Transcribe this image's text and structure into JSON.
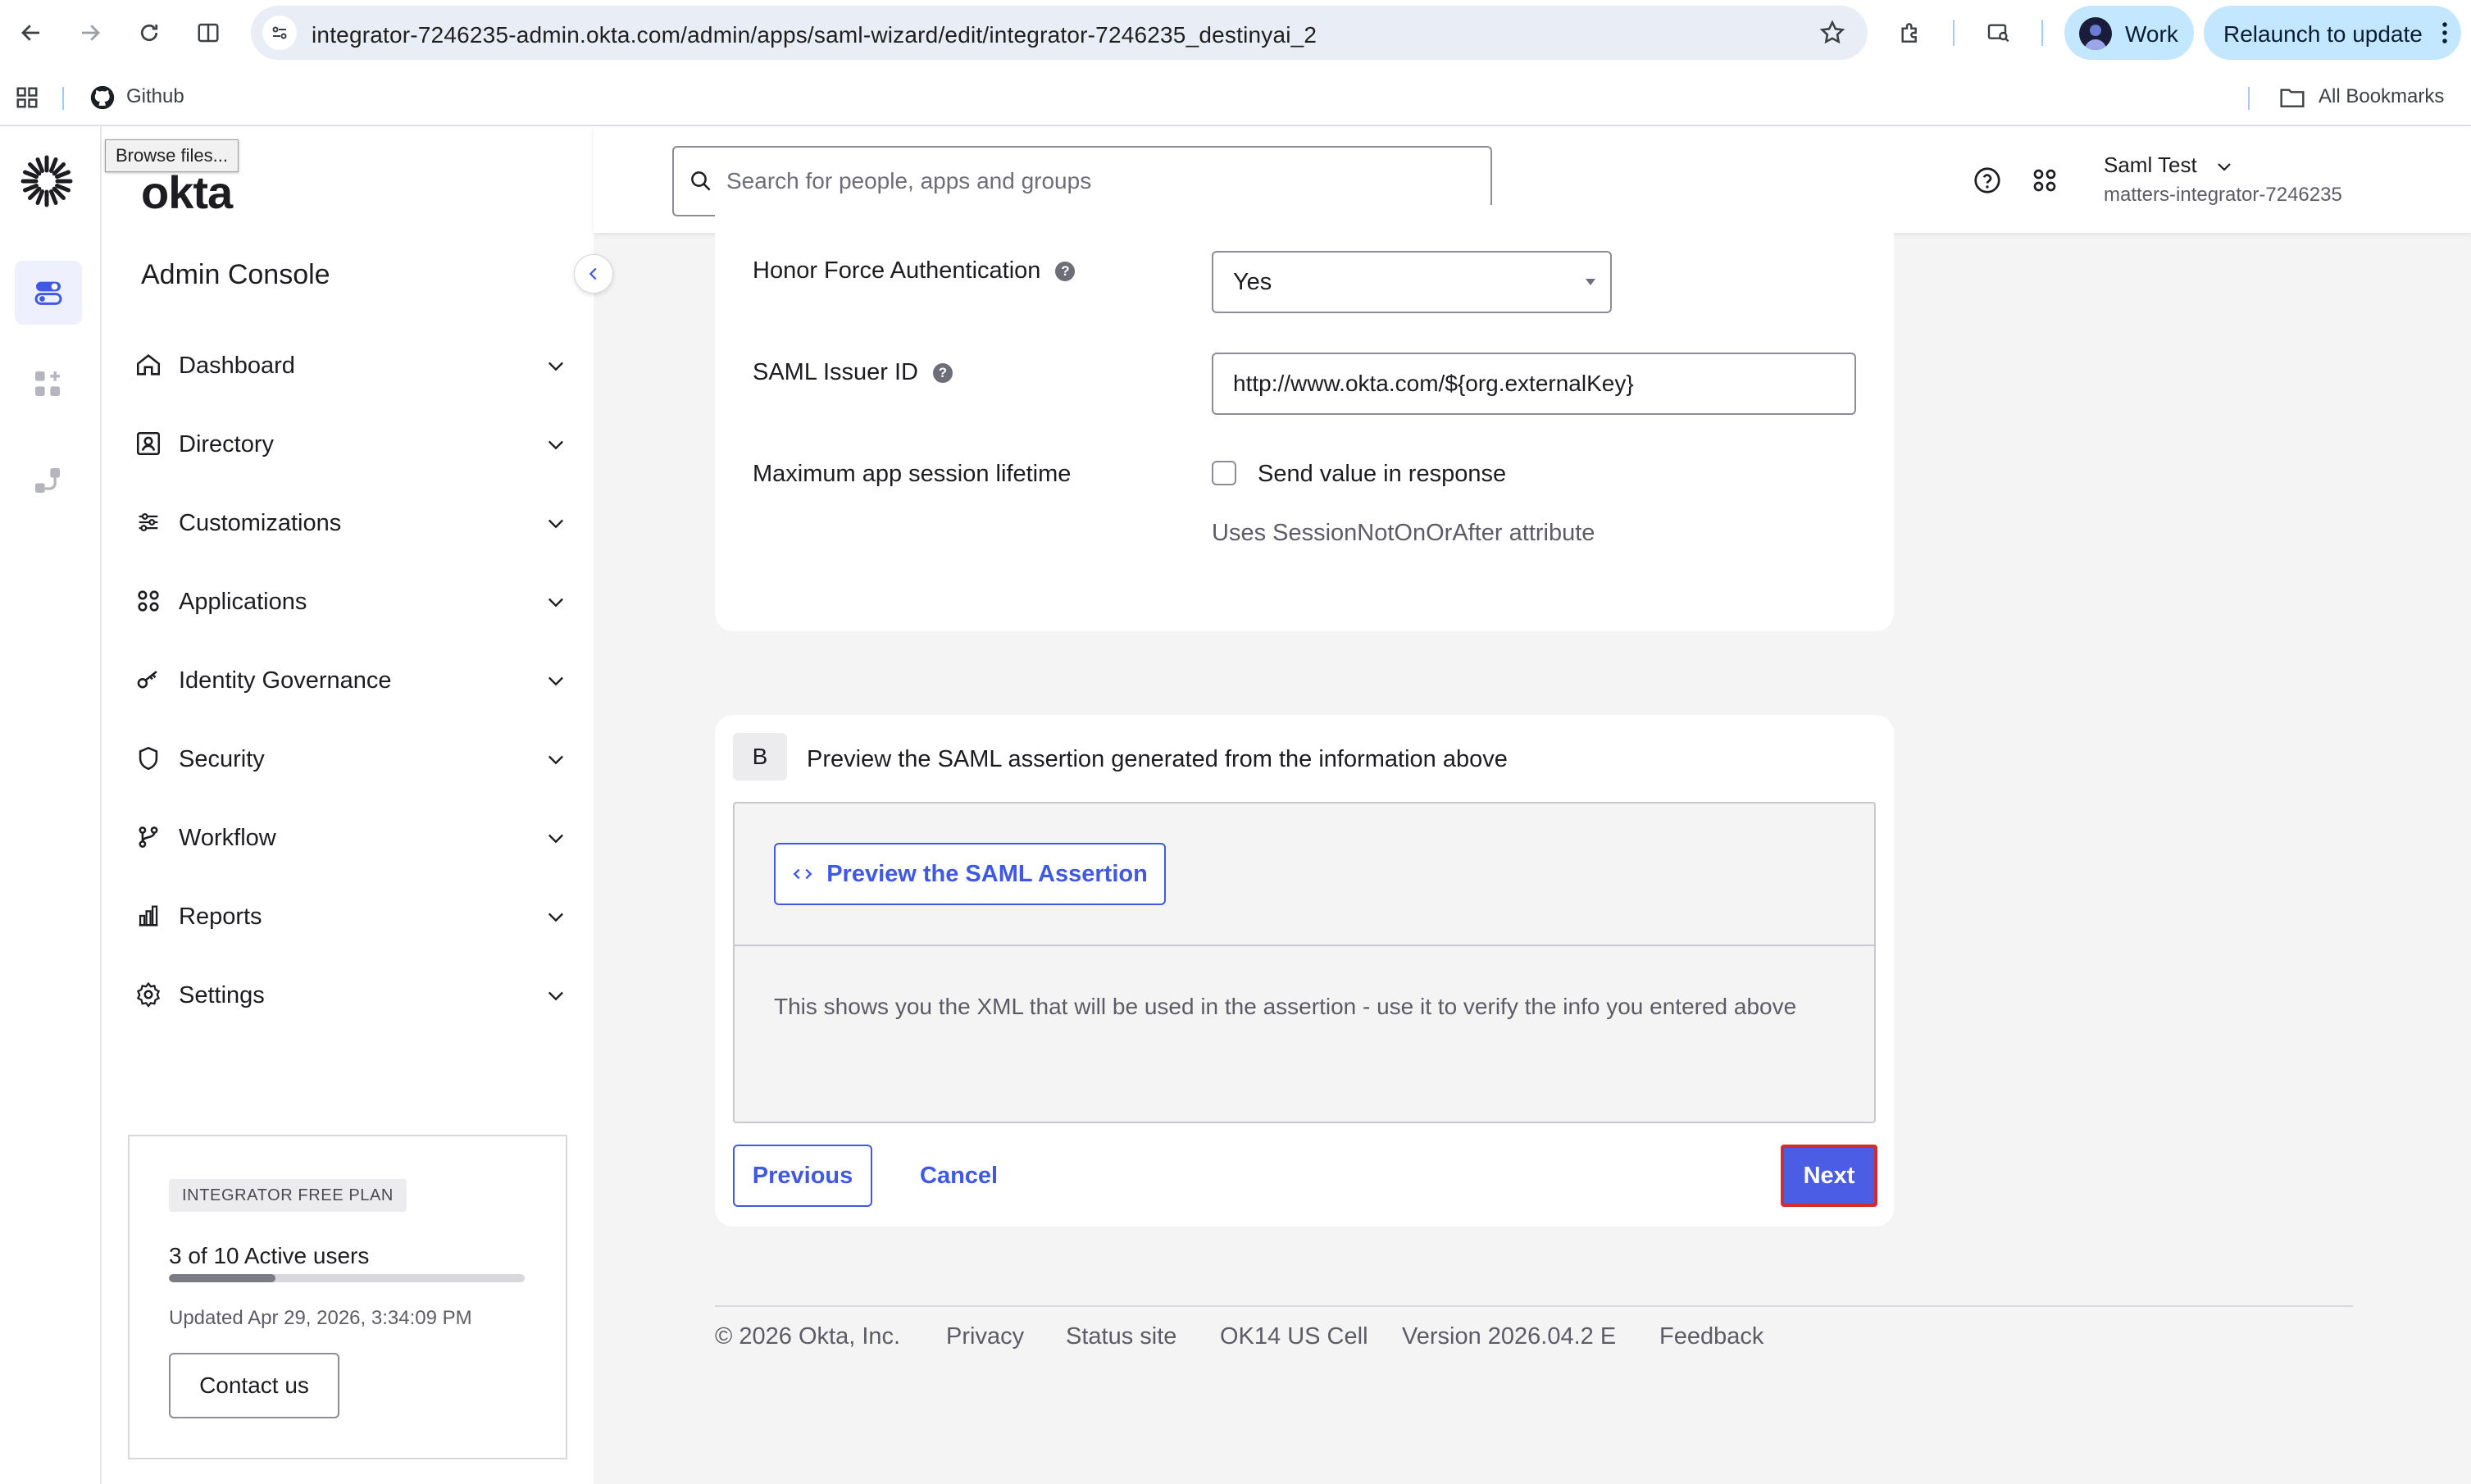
{
  "browser": {
    "url": "integrator-7246235-admin.okta.com/admin/apps/saml-wizard/edit/integrator-7246235_destinyai_2",
    "profile_label": "Work",
    "relaunch_label": "Relaunch to update",
    "bookmarks": [
      {
        "label": "Github"
      }
    ],
    "all_bookmarks_label": "All Bookmarks",
    "tooltip": "Browse files..."
  },
  "brand": {
    "logo_text": "okta",
    "accent": "#3f59e4"
  },
  "sidebar": {
    "title": "Admin Console",
    "items": [
      {
        "label": "Dashboard",
        "icon": "home-icon"
      },
      {
        "label": "Directory",
        "icon": "directory-icon"
      },
      {
        "label": "Customizations",
        "icon": "sliders-icon"
      },
      {
        "label": "Applications",
        "icon": "grid-icon"
      },
      {
        "label": "Identity Governance",
        "icon": "key-icon"
      },
      {
        "label": "Security",
        "icon": "shield-icon"
      },
      {
        "label": "Workflow",
        "icon": "workflow-icon"
      },
      {
        "label": "Reports",
        "icon": "chart-icon"
      },
      {
        "label": "Settings",
        "icon": "gear-icon"
      }
    ],
    "plan": {
      "badge": "INTEGRATOR FREE PLAN",
      "users": "3 of 10 Active users",
      "users_fraction": 0.3,
      "updated": "Updated Apr 29, 2026, 3:34:09 PM",
      "contact_label": "Contact us"
    }
  },
  "header": {
    "search_placeholder": "Search for people, apps and groups",
    "user_name": "Saml Test",
    "org_name": "matters-integrator-7246235"
  },
  "form": {
    "honor_force_auth_label": "Honor Force Authentication",
    "honor_force_auth_value": "Yes",
    "issuer_id_label": "SAML Issuer ID",
    "issuer_id_value": "http://www.okta.com/${org.externalKey}",
    "max_session_label": "Maximum app session lifetime",
    "send_value_label": "Send value in response",
    "send_value_hint": "Uses SessionNotOnOrAfter attribute"
  },
  "preview": {
    "step": "B",
    "title": "Preview the SAML assertion generated from the information above",
    "button_label": "Preview the SAML Assertion",
    "description": "This shows you the XML that will be used in the assertion - use it to verify the info you entered above"
  },
  "actions": {
    "previous": "Previous",
    "cancel": "Cancel",
    "next": "Next"
  },
  "footer": {
    "copyright": "© 2026 Okta, Inc.",
    "privacy": "Privacy",
    "status": "Status site",
    "cell": "OK14 US Cell",
    "version": "Version 2026.04.2 E",
    "feedback": "Feedback"
  }
}
